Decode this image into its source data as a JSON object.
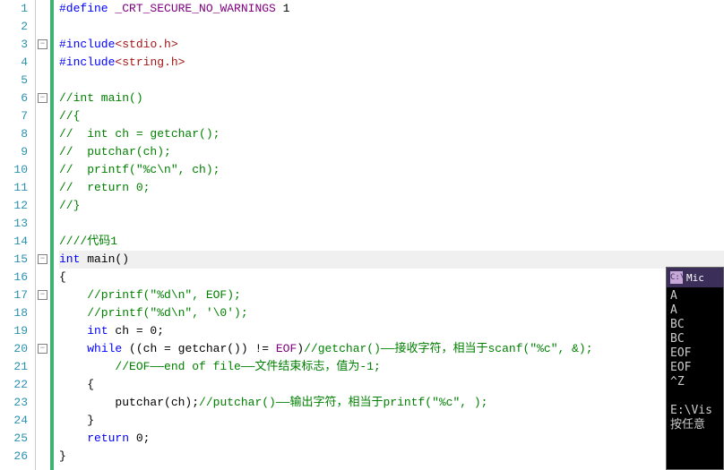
{
  "gutter": {
    "start": 1,
    "end": 26
  },
  "fold_marks": [
    {
      "line": 3,
      "sym": "−"
    },
    {
      "line": 6,
      "sym": "−"
    },
    {
      "line": 15,
      "sym": "−"
    },
    {
      "line": 17,
      "sym": "−"
    },
    {
      "line": 20,
      "sym": "−"
    }
  ],
  "code": {
    "l1": {
      "pre": "#define ",
      "macro": "_CRT_SECURE_NO_WARNINGS",
      "post": " 1"
    },
    "l3": {
      "inc": "#include",
      "ang1": "<",
      "hdr": "stdio.h",
      "ang2": ">"
    },
    "l4": {
      "inc": "#include",
      "ang1": "<",
      "hdr": "string.h",
      "ang2": ">"
    },
    "l6": "//int main()",
    "l7": "//{",
    "l8": "//  int ch = getchar();",
    "l9": "//  putchar(ch);",
    "l10": "//  printf(\"%c\\n\", ch);",
    "l11": "//  return 0;",
    "l12": "//}",
    "l14": "////代码1",
    "l15": {
      "kw_int": "int",
      "main": " main",
      "paren": "()"
    },
    "l16": "{",
    "l17": "    //printf(\"%d\\n\", EOF);",
    "l18": "    //printf(\"%d\\n\", '\\0');",
    "l19": {
      "ind": "    ",
      "kw_int": "int",
      "rest": " ch = 0;"
    },
    "l20": {
      "ind": "    ",
      "kw_while": "while",
      "mid1": " ((ch = getchar()) != ",
      "eof": "EOF",
      "mid2": ")",
      "cmt": "//getchar()——接收字符，相当于scanf(\"%c\", &);"
    },
    "l21": "        //EOF——end of file——文件结束标志，值为-1;",
    "l22": "    {",
    "l23": {
      "ind": "        ",
      "call": "putchar(ch);",
      "cmt": "//putchar()——输出字符，相当于printf(\"%c\", );"
    },
    "l24": "    }",
    "l25": {
      "ind": "    ",
      "kw_return": "return",
      "rest": " 0;"
    },
    "l26": "}"
  },
  "console": {
    "icon": "C:\\",
    "title": "Mic",
    "lines": [
      "A",
      "A",
      "BC",
      "BC",
      "EOF",
      "EOF",
      "^Z",
      "",
      "E:\\Vis",
      "按任意"
    ]
  }
}
